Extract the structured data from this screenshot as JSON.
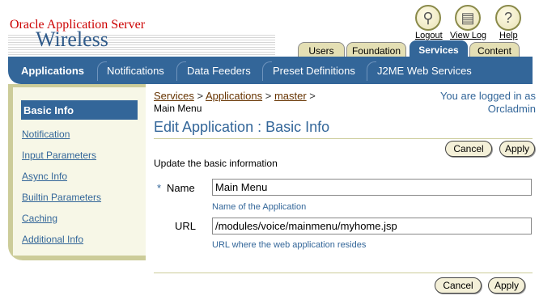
{
  "branding": {
    "top": "Oracle Application Server",
    "main": "Wireless"
  },
  "global_links": [
    {
      "label": "Logout",
      "icon": "logout-icon",
      "glyph": "⚲"
    },
    {
      "label": "View Log",
      "icon": "view-log-icon",
      "glyph": "▤"
    },
    {
      "label": "Help",
      "icon": "help-icon",
      "glyph": "?"
    }
  ],
  "top_tabs": [
    {
      "label": "Users",
      "active": false
    },
    {
      "label": "Foundation",
      "active": false
    },
    {
      "label": "Services",
      "active": true
    },
    {
      "label": "Content",
      "active": false
    }
  ],
  "nav": [
    {
      "label": "Applications",
      "active": true
    },
    {
      "label": "Notifications",
      "active": false
    },
    {
      "label": "Data Feeders",
      "active": false
    },
    {
      "label": "Preset Definitions",
      "active": false
    },
    {
      "label": "J2ME Web Services",
      "active": false
    }
  ],
  "sidebar": {
    "active": "Basic Info",
    "items": [
      "Notification",
      "Input Parameters",
      "Async Info",
      "Builtin Parameters",
      "Caching",
      "Additional Info"
    ]
  },
  "breadcrumb": {
    "items": [
      "Services",
      "Applications",
      "master"
    ],
    "separator": ">",
    "current": "Main Menu"
  },
  "login": {
    "line1": "You are logged in as",
    "line2": "Orcladmin"
  },
  "page_title": "Edit Application : Basic Info",
  "buttons": {
    "cancel": "Cancel",
    "apply": "Apply"
  },
  "instructions": "Update the basic information",
  "form": {
    "required_mark": "*",
    "name_label": "Name",
    "name_value": "Main Menu",
    "name_hint": "Name of the Application",
    "url_label": "URL",
    "url_value": "/modules/voice/mainmenu/myhome.jsp",
    "url_hint": "URL where the web application resides"
  },
  "colors": {
    "accent": "#336699",
    "tab": "#cccc99",
    "brand_red": "#cc0000"
  }
}
